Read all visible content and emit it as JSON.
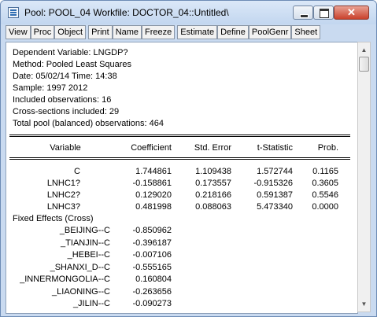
{
  "window": {
    "title": "Pool: POOL_04    Workfile: DOCTOR_04::Untitled\\",
    "icon": "pool-object-icon",
    "controls": {
      "minimize": "minimize-icon",
      "maximize": "maximize-icon",
      "close": "close-icon",
      "close_glyph": "✕"
    }
  },
  "toolbar": {
    "buttons": [
      "View",
      "Proc",
      "Object",
      "Print",
      "Name",
      "Freeze",
      "Estimate",
      "Define",
      "PoolGenr",
      "Sheet"
    ]
  },
  "output": {
    "header_lines": [
      "Dependent Variable: LNGDP?",
      "Method: Pooled Least Squares",
      "Date: 05/02/14   Time: 14:38",
      "Sample: 1997 2012",
      "Included observations: 16",
      "Cross-sections included: 29",
      "Total pool (balanced) observations: 464"
    ],
    "columns": [
      "Variable",
      "Coefficient",
      "Std. Error",
      "t-Statistic",
      "Prob."
    ],
    "rows": [
      {
        "variable": "C",
        "coefficient": "1.744861",
        "std_error": "1.109438",
        "t_stat": "1.572744",
        "prob": "0.1165"
      },
      {
        "variable": "LNHC1?",
        "coefficient": "-0.158861",
        "std_error": "0.173557",
        "t_stat": "-0.915326",
        "prob": "0.3605"
      },
      {
        "variable": "LNHC2?",
        "coefficient": "0.129020",
        "std_error": "0.218166",
        "t_stat": "0.591387",
        "prob": "0.5546"
      },
      {
        "variable": "LNHC3?",
        "coefficient": "0.481998",
        "std_error": "0.088063",
        "t_stat": "5.473340",
        "prob": "0.0000"
      }
    ],
    "fixed_effects_label": "Fixed Effects (Cross)",
    "fixed_effects": [
      {
        "name": "_BEIJING--C",
        "value": "-0.850962"
      },
      {
        "name": "_TIANJIN--C",
        "value": "-0.396187"
      },
      {
        "name": "_HEBEI--C",
        "value": "-0.007106"
      },
      {
        "name": "_SHANXI_D--C",
        "value": "-0.555165"
      },
      {
        "name": "_INNERMONGOLIA--C",
        "value": "0.160804"
      },
      {
        "name": "_LIAONING--C",
        "value": "-0.263656"
      },
      {
        "name": "_JILIN--C",
        "value": "-0.090273"
      }
    ]
  },
  "scrollbar": {
    "up_icon": "scroll-up-arrow-icon",
    "down_icon": "scroll-down-arrow-icon",
    "up_glyph": "▲",
    "down_glyph": "▼"
  },
  "colors": {
    "titlebar": "#c9daf0",
    "close_button": "#c9412c"
  }
}
